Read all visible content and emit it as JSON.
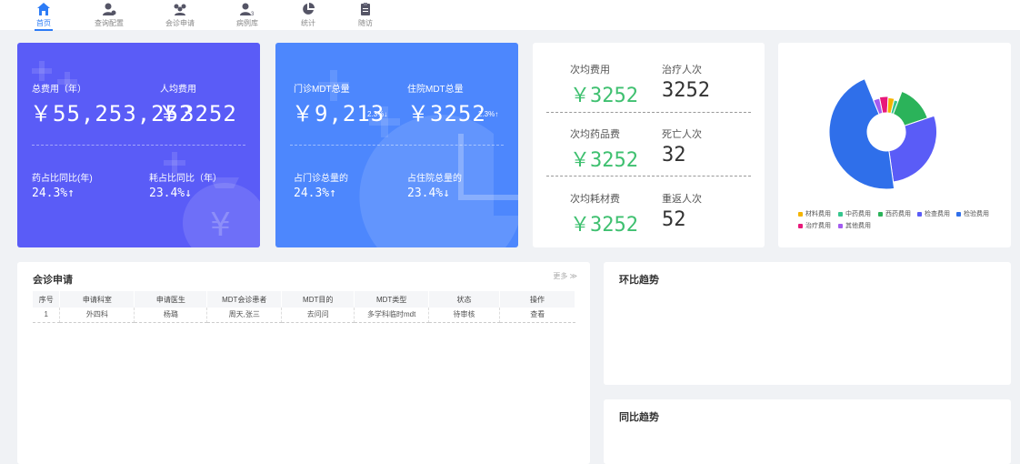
{
  "nav": [
    {
      "label": "首页",
      "icon": "home-icon",
      "active": true
    },
    {
      "label": "查询配置",
      "icon": "user-settings-icon",
      "active": false
    },
    {
      "label": "会诊申请",
      "icon": "group-icon",
      "active": false
    },
    {
      "label": "病例库",
      "icon": "user-3-icon",
      "active": false
    },
    {
      "label": "统计",
      "icon": "pie-chart-icon",
      "active": false
    },
    {
      "label": "随访",
      "icon": "clipboard-icon",
      "active": false
    }
  ],
  "card1": {
    "total_label": "总费用（年）",
    "total_value": "￥55,253,252",
    "per_label": "人均费用",
    "per_value": "￥3252",
    "drug_label": "药占比同比(年)",
    "drug_value": "24.3%↑",
    "consum_label": "耗占比同比（年）",
    "consum_value": "23.4%↓"
  },
  "card2": {
    "out_label": "门诊MDT总量",
    "out_value": "￥9,213",
    "out_pct": "2.3%↓",
    "in_label": "住院MDT总量",
    "in_value": "￥3252",
    "in_pct": "2.3%↑",
    "out_ratio_label": "占门诊总量的",
    "out_ratio_value": "24.3%↑",
    "in_ratio_label": "占住院总量的",
    "in_ratio_value": "23.4%↓"
  },
  "card3": {
    "r1": {
      "l_label": "次均费用",
      "l_value": "￥3252",
      "r_label": "治疗人次",
      "r_value": "3252"
    },
    "r2": {
      "l_label": "次均药品费",
      "l_value": "￥3252",
      "r_label": "死亡人次",
      "r_value": "32"
    },
    "r3": {
      "l_label": "次均耗材费",
      "l_value": "￥3252",
      "r_label": "重返人次",
      "r_value": "52"
    }
  },
  "chart_data": {
    "type": "pie",
    "categories": [
      "材料费用",
      "中药费用",
      "西药费用",
      "检查费用",
      "检验费用",
      "治疗费用",
      "其他费用"
    ],
    "values": [
      3,
      2,
      14,
      28,
      46,
      4,
      3
    ],
    "colors": [
      "#f5b400",
      "#36c68f",
      "#2bb35a",
      "#5a5cf7",
      "#2f6fea",
      "#e8197a",
      "#a35cf0"
    ],
    "legend_position": "bottom"
  },
  "consult": {
    "title": "会诊申请",
    "more": "更多 ≫",
    "columns": [
      "序号",
      "申请科室",
      "申请医生",
      "MDT会诊患者",
      "MDT目的",
      "MDT类型",
      "状态",
      "操作"
    ],
    "rows": [
      [
        "1",
        "外四科",
        "杨璐",
        "周天,张三",
        "去问问",
        "多学科临时mdt",
        "待审核",
        "查看"
      ]
    ]
  },
  "trend1": {
    "title": "环比趋势"
  },
  "trend2": {
    "title": "同比趋势"
  }
}
